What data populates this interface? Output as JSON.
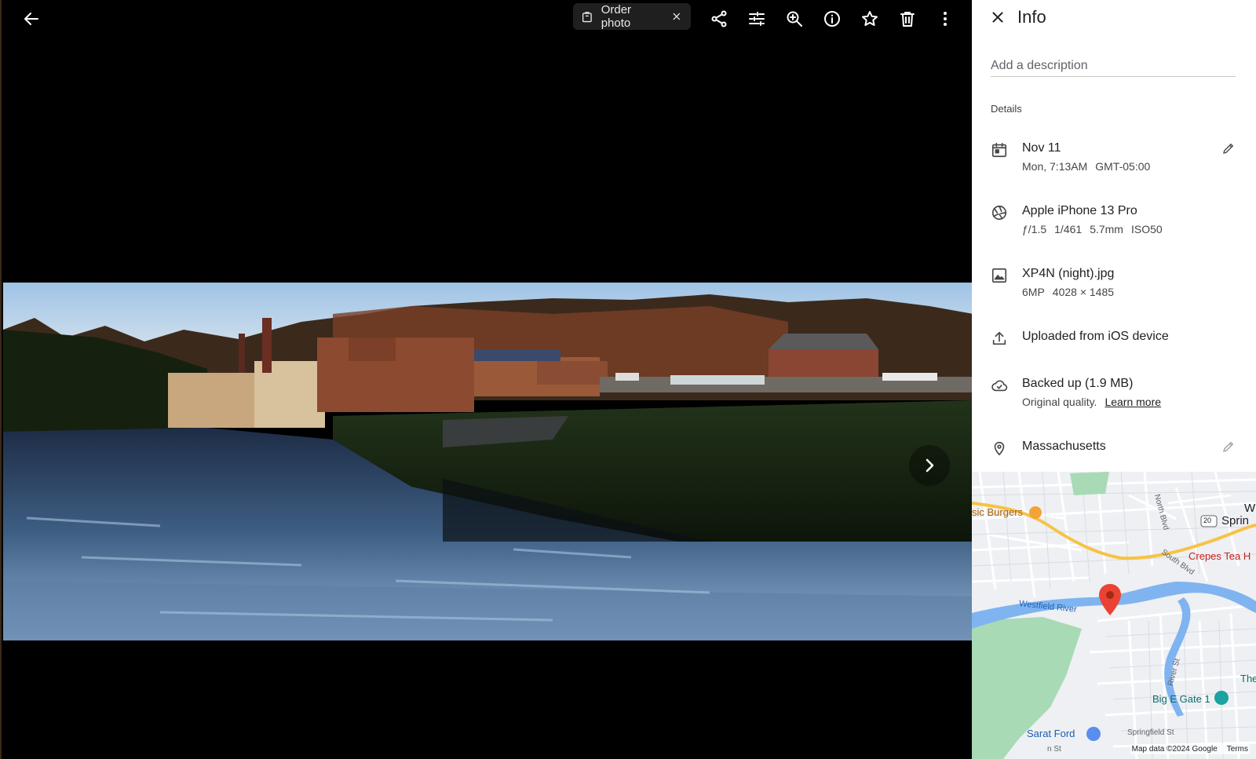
{
  "toolbar": {
    "order_photo_label": "Order photo"
  },
  "info_panel": {
    "title": "Info",
    "description_placeholder": "Add a description",
    "details_label": "Details",
    "date": {
      "primary": "Nov 11",
      "time": "Mon, 7:13AM",
      "timezone": "GMT-05:00"
    },
    "camera": {
      "primary": "Apple iPhone 13 Pro",
      "aperture": "ƒ/1.5",
      "shutter": "1/461",
      "focal": "5.7mm",
      "iso": "ISO50"
    },
    "file": {
      "primary": "XP4N (night).jpg",
      "megapixels": "6MP",
      "dimensions": "4028 × 1485"
    },
    "upload": {
      "primary": "Uploaded from iOS device"
    },
    "backup": {
      "primary": "Backed up (1.9 MB)",
      "secondary": "Original quality.",
      "link": "Learn more"
    },
    "location": {
      "primary": "Massachusetts"
    }
  },
  "map": {
    "labels": {
      "burgers": "sic Burgers",
      "north_blvd": "North Blvd",
      "route": "20",
      "spring": "Sprin",
      "w": "W",
      "south_blvd": "South Blvd",
      "crepes": "Crepes Tea H",
      "westfield_river": "Westfield River",
      "river_st": "River St",
      "the": "The",
      "big_e": "Big E Gate 1",
      "sarat": "Sarat Ford",
      "springfield_st": "Springfield St",
      "st": "n St"
    },
    "credit": "Map data ©2024 Google",
    "terms": "Terms"
  },
  "colors": {
    "pin": "#ea4335",
    "water": "#7fb4f0",
    "park": "#a8dab5",
    "highway": "#f6c344"
  }
}
